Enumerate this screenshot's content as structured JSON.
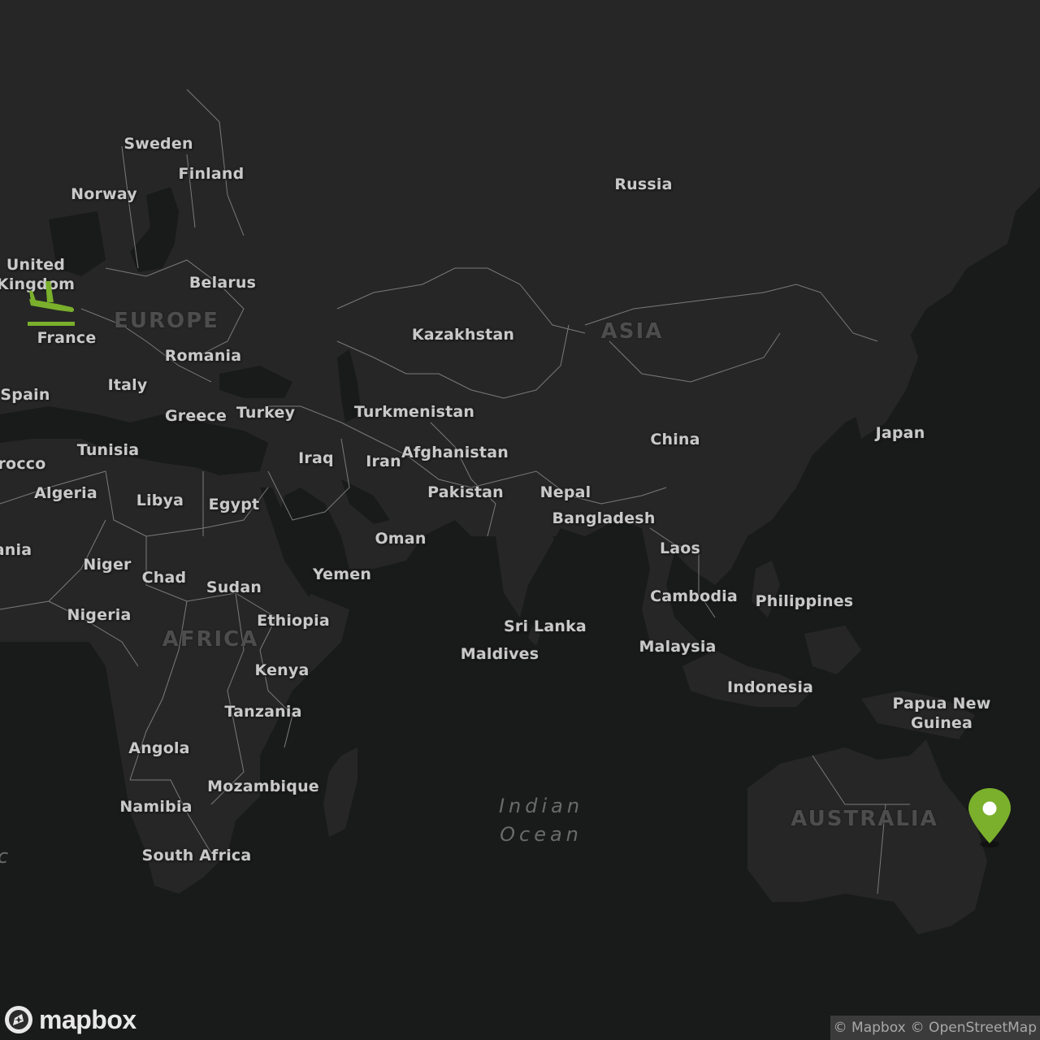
{
  "countries": {
    "sweden": "Sweden",
    "finland": "Finland",
    "norway": "Norway",
    "russia": "Russia",
    "uk": "United\nKingdom",
    "belarus": "Belarus",
    "france": "France",
    "romania": "Romania",
    "kazakhstan": "Kazakhstan",
    "italy": "Italy",
    "spain": "Spain",
    "greece": "Greece",
    "turkey": "Turkey",
    "turkmenistan": "Turkmenistan",
    "japan": "Japan",
    "china": "China",
    "tunisia": "Tunisia",
    "afghanistan": "Afghanistan",
    "morocco": "rocco",
    "iraq": "Iraq",
    "iran": "Iran",
    "algeria": "Algeria",
    "libya": "Libya",
    "egypt": "Egypt",
    "pakistan": "Pakistan",
    "nepal": "Nepal",
    "bangladesh": "Bangladesh",
    "oman": "Oman",
    "mauritania": "ania",
    "laos": "Laos",
    "niger": "Niger",
    "chad": "Chad",
    "sudan": "Sudan",
    "yemen": "Yemen",
    "cambodia": "Cambodia",
    "philippines": "Philippines",
    "nigeria": "Nigeria",
    "ethiopia": "Ethiopia",
    "sri_lanka": "Sri Lanka",
    "malaysia": "Malaysia",
    "maldives": "Maldives",
    "kenya": "Kenya",
    "indonesia": "Indonesia",
    "papua": "Papua New\nGuinea",
    "tanzania": "Tanzania",
    "angola": "Angola",
    "mozambique": "Mozambique",
    "namibia": "Namibia",
    "south_africa": "South Africa"
  },
  "continents": {
    "europe": "EUROPE",
    "asia": "ASIA",
    "africa": "AFRICA",
    "australia": "AUSTRALIA"
  },
  "oceans": {
    "indian_1": "Indian",
    "indian_2": "Ocean",
    "atlantic_fragment": "c"
  },
  "brand": {
    "logo_text": "mapbox"
  },
  "attribution": {
    "mapbox": "© Mapbox",
    "osm": "© OpenStreetMap"
  },
  "markers": {
    "origin_icon": "airplane-arrival-icon",
    "destination_icon": "map-pin-icon"
  },
  "colors": {
    "accent": "#7ab02c",
    "background": "#191a1a",
    "land": "#262626",
    "border": "#7a7a7a"
  }
}
